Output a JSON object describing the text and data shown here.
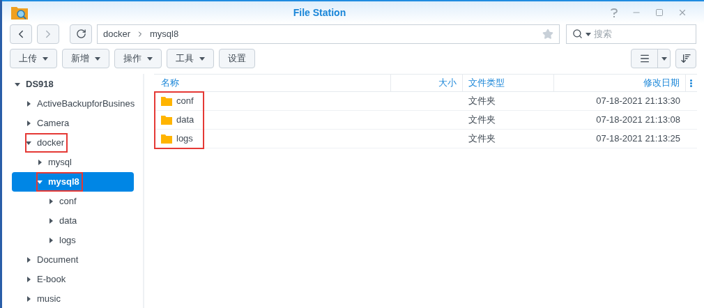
{
  "window": {
    "title": "File Station"
  },
  "nav": {
    "path": [
      "docker",
      "mysql8"
    ],
    "search_placeholder": "搜索"
  },
  "toolbar": [
    "上传",
    "新增",
    "操作",
    "工具",
    "设置"
  ],
  "toolbar_dropdown": [
    true,
    true,
    true,
    true,
    false
  ],
  "tree": [
    {
      "label": "DS918",
      "expanded": true,
      "selected": false,
      "highlighted": false,
      "children": [
        {
          "label": "ActiveBackupforBusines",
          "expanded": false,
          "selected": false,
          "highlighted": false
        },
        {
          "label": "Camera",
          "expanded": false,
          "selected": false,
          "highlighted": false
        },
        {
          "label": "docker",
          "expanded": true,
          "selected": false,
          "highlighted": true,
          "children": [
            {
              "label": "mysql",
              "expanded": false,
              "selected": false,
              "highlighted": false
            },
            {
              "label": "mysql8",
              "expanded": true,
              "selected": true,
              "highlighted": true,
              "children": [
                {
                  "label": "conf",
                  "expanded": false,
                  "selected": false,
                  "highlighted": false
                },
                {
                  "label": "data",
                  "expanded": false,
                  "selected": false,
                  "highlighted": false
                },
                {
                  "label": "logs",
                  "expanded": false,
                  "selected": false,
                  "highlighted": false
                }
              ]
            }
          ]
        },
        {
          "label": "Document",
          "expanded": false,
          "selected": false,
          "highlighted": false
        },
        {
          "label": "E-book",
          "expanded": false,
          "selected": false,
          "highlighted": false
        },
        {
          "label": "music",
          "expanded": false,
          "selected": false,
          "highlighted": false
        }
      ]
    }
  ],
  "table": {
    "columns": [
      "名称",
      "大小",
      "文件类型",
      "修改日期"
    ],
    "names_highlighted": true,
    "rows": [
      {
        "name": "conf",
        "type": "文件夹",
        "modified": "07-18-2021 21:13:30"
      },
      {
        "name": "data",
        "type": "文件夹",
        "modified": "07-18-2021 21:13:08"
      },
      {
        "name": "logs",
        "type": "文件夹",
        "modified": "07-18-2021 21:13:25"
      }
    ]
  }
}
